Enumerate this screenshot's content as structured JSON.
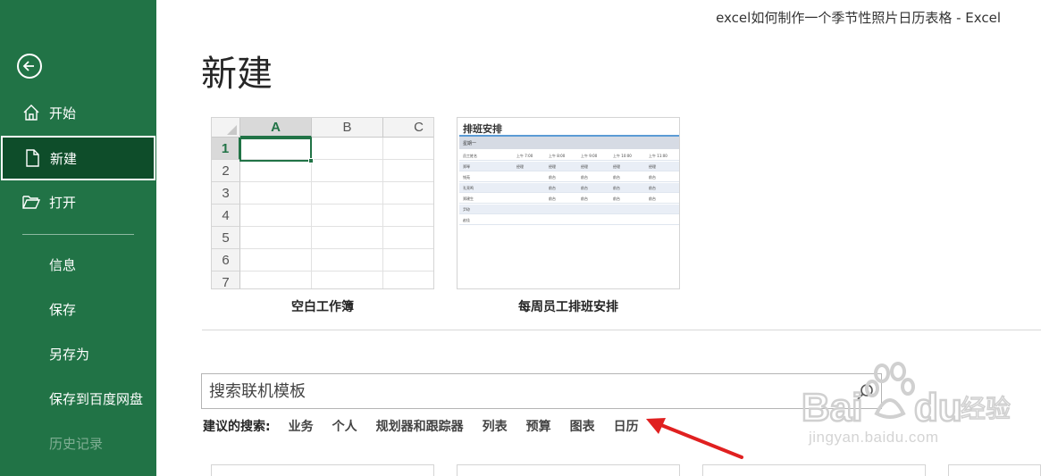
{
  "window": {
    "title": "excel如何制作一个季节性照片日历表格  -  Excel"
  },
  "sidebar": {
    "items": [
      {
        "label": "开始",
        "icon": "home-icon"
      },
      {
        "label": "新建",
        "icon": "new-document-icon",
        "active": true
      },
      {
        "label": "打开",
        "icon": "open-folder-icon"
      },
      {
        "label": "信息"
      },
      {
        "label": "保存"
      },
      {
        "label": "另存为"
      },
      {
        "label": "保存到百度网盘"
      },
      {
        "label": "历史记录",
        "disabled": true
      }
    ],
    "back_icon": "back-arrow-icon"
  },
  "main": {
    "title": "新建",
    "templates": [
      {
        "caption": "空白工作簿",
        "columns": [
          "A",
          "B",
          "C"
        ],
        "rows": [
          "1",
          "2",
          "3",
          "4",
          "5",
          "6",
          "7"
        ]
      },
      {
        "caption": "每周员工排班安排",
        "preview": {
          "title": "排班安排",
          "band": "星期一",
          "header": [
            "员工姓名",
            "上午 7:00",
            "上午 8:00",
            "上午 9:00",
            "上午 10:00",
            "上午 11:00"
          ],
          "rows": [
            [
              "郑琴",
              "经理",
              "经理",
              "经理",
              "经理",
              "经理"
            ],
            [
              "钱苑",
              "",
              "前台",
              "前台",
              "前台",
              "前台"
            ],
            [
              "孔亮鸣",
              "",
              "前台",
              "前台",
              "前台",
              "前台"
            ],
            [
              "郑建生",
              "",
              "前台",
              "前台",
              "前台",
              "前台"
            ],
            [
              "尹琼",
              "",
              "",
              "",
              "",
              ""
            ],
            [
              "赵佳",
              "",
              "",
              "",
              "",
              ""
            ]
          ]
        }
      }
    ],
    "search": {
      "placeholder": "搜索联机模板",
      "icon": "search-icon"
    },
    "suggested": {
      "label": "建议的搜索:",
      "links": [
        "业务",
        "个人",
        "规划器和跟踪器",
        "列表",
        "预算",
        "图表",
        "日历"
      ]
    }
  },
  "watermark": {
    "text": "jingyan.baidu.com",
    "logo": "Baidu 经验"
  },
  "colors": {
    "accent": "#217346",
    "active_nav": "#0e4d2a",
    "arrow": "#e02020"
  }
}
